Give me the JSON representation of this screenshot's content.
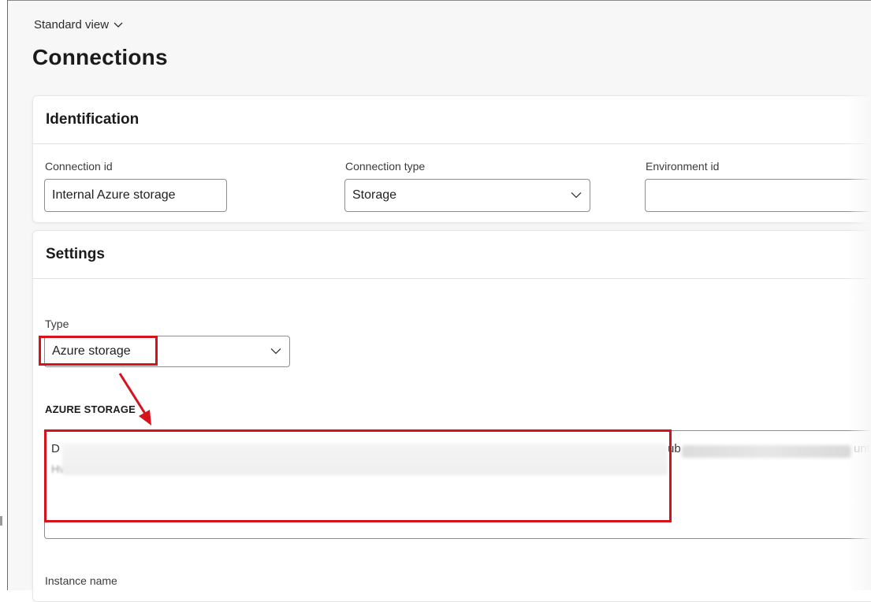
{
  "header": {
    "view_label": "Standard view",
    "title": "Connections"
  },
  "identification": {
    "heading": "Identification",
    "connection_id": {
      "label": "Connection id",
      "value": "Internal Azure storage"
    },
    "connection_type": {
      "label": "Connection type",
      "value": "Storage"
    },
    "environment_id": {
      "label": "Environment id",
      "value": ""
    }
  },
  "settings": {
    "heading": "Settings",
    "type": {
      "label": "Type",
      "value": "Azure storage"
    },
    "azure_storage": {
      "heading": "AZURE STORAGE",
      "connection_string_fragment_start": "D",
      "connection_string_fragment_mid": "ub",
      "connection_string_fragment_end": "untI",
      "connection_string_line2": "HvJA=="
    },
    "instance_name": {
      "label": "Instance name"
    }
  },
  "colors": {
    "highlight": "#d6121b",
    "border": "#8f8f8f",
    "background": "#f7f7f7"
  }
}
